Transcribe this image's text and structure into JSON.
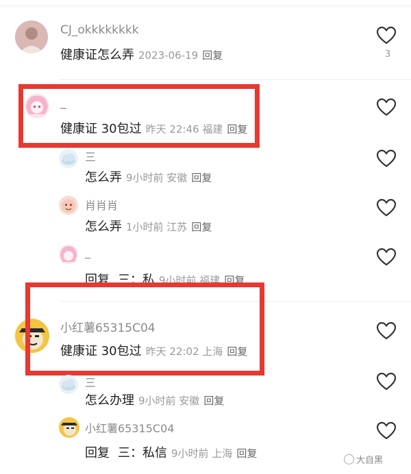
{
  "comments": [
    {
      "username": "CJ_okkkkkkkk",
      "text": "健康证怎么弄",
      "meta": "2023-06-19",
      "reply": "回复",
      "likes": "3",
      "avatar": "photo"
    },
    {
      "username": "_",
      "text": "健康证 30包过",
      "meta": "昨天 22:46 福建",
      "reply": "回复",
      "avatar": "anime-girl"
    },
    {
      "username": "三",
      "text": "怎么弄",
      "meta": "9小时前 安徽",
      "reply": "回复",
      "avatar": "cloud"
    },
    {
      "username": "肖肖肖",
      "text": "怎么弄",
      "meta": "1小时前 江苏",
      "reply": "回复",
      "avatar": "cartoon"
    },
    {
      "username": "_",
      "text": "回复",
      "text2": "三：私",
      "meta": "9小时前 福建",
      "reply": "回复",
      "avatar": "anime-girl"
    },
    {
      "username": "小红薯65315C04",
      "text": "健康证 30包过",
      "meta": "昨天 22:02 上海",
      "reply": "回复",
      "avatar": "meme-face"
    },
    {
      "username": "三",
      "text": "怎么办理",
      "meta": "9小时前 安徽",
      "reply": "回复",
      "avatar": "cloud"
    },
    {
      "username": "小红薯65315C04",
      "text": "回复",
      "text2": "三：私信",
      "meta": "9小时前 上海",
      "reply": "回复",
      "avatar": "meme-face"
    }
  ],
  "watermark": "大自黑",
  "colors": {
    "highlight_box": "#e8382f",
    "username": "#8a8a8a",
    "meta": "#999999"
  }
}
